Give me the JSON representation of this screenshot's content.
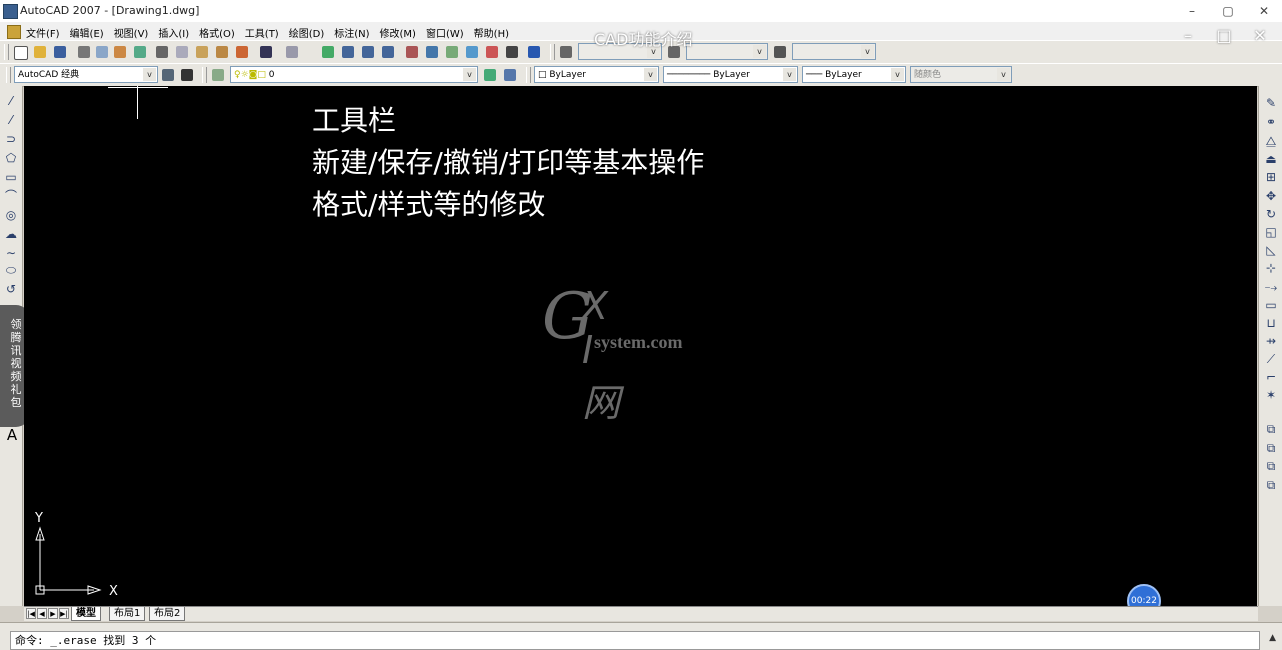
{
  "window": {
    "title": "AutoCAD 2007 - [Drawing1.dwg]",
    "controls": [
      "–",
      "▢",
      "✕"
    ]
  },
  "menubar": {
    "items": [
      "文件(F)",
      "编辑(E)",
      "视图(V)",
      "插入(I)",
      "格式(O)",
      "工具(T)",
      "绘图(D)",
      "标注(N)",
      "修改(M)",
      "窗口(W)",
      "帮助(H)"
    ]
  },
  "overlay": {
    "title": "CAD功能介绍",
    "controls": [
      "–",
      "□",
      "✕"
    ],
    "timer": "00:22"
  },
  "toolbar2": {
    "workspace": "AutoCAD 经典",
    "layer": "0",
    "color": "ByLayer",
    "linetype": "ByLayer",
    "lineweight": "ByLayer",
    "plotstyle": "随颜色"
  },
  "notes": {
    "line1": "工具栏",
    "line2": "新建/保存/撤销/打印等基本操作",
    "line3": "格式/样式等的修改"
  },
  "watermark": {
    "g": "G",
    "xi": "X I 网",
    "site": "system.com"
  },
  "promo": {
    "text": "领腾讯视频礼包"
  },
  "ucs": {
    "x_label": "X",
    "y_label": "Y"
  },
  "layout_tabs": {
    "nav": [
      "|◀",
      "◀",
      "▶",
      "▶|"
    ],
    "tabs": [
      "模型",
      "布局1",
      "布局2"
    ]
  },
  "command": {
    "text": "命令: _.erase 找到 3 个"
  },
  "lefttools": {
    "last_letter": "A"
  }
}
